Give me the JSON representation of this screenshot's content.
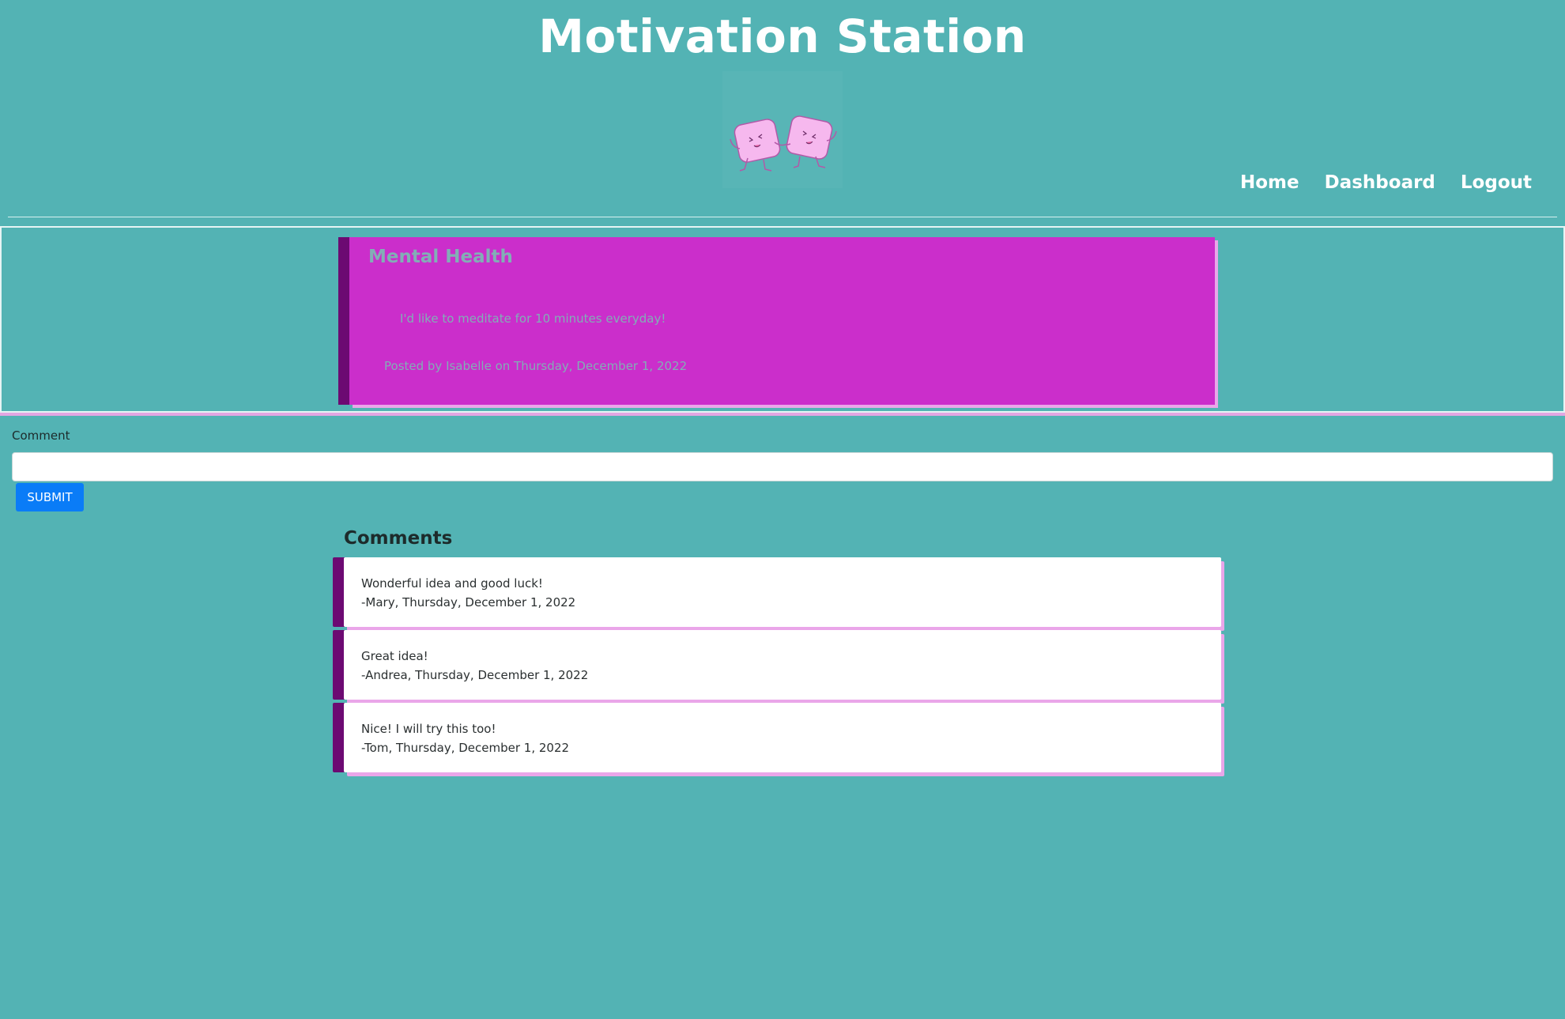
{
  "header": {
    "title": "Motivation Station",
    "logo_icon": "two-dancing-marshmallows-logo"
  },
  "nav": {
    "items": [
      {
        "label": "Home"
      },
      {
        "label": "Dashboard"
      },
      {
        "label": "Logout"
      }
    ]
  },
  "post": {
    "title": "Mental Health",
    "body": "I'd like to meditate for 10 minutes everyday!",
    "meta": "Posted by Isabelle on Thursday, December 1, 2022"
  },
  "comment_form": {
    "label": "Comment",
    "value": "",
    "submit_label": "SUBMIT"
  },
  "comments": {
    "heading": "Comments",
    "items": [
      {
        "text": "Wonderful idea and good luck!",
        "author": "-Mary, Thursday, December 1, 2022"
      },
      {
        "text": "Great idea!",
        "author": "-Andrea, Thursday, December 1, 2022"
      },
      {
        "text": "Nice! I will try this too!",
        "author": "-Tom, Thursday, December 1, 2022"
      }
    ]
  },
  "colors": {
    "background": "#53b3b4",
    "post_card": "#cb2ecb",
    "accent_dark": "#6c0a72",
    "accent_light": "#eaa6e9",
    "submit_button": "#0a7cf7"
  }
}
